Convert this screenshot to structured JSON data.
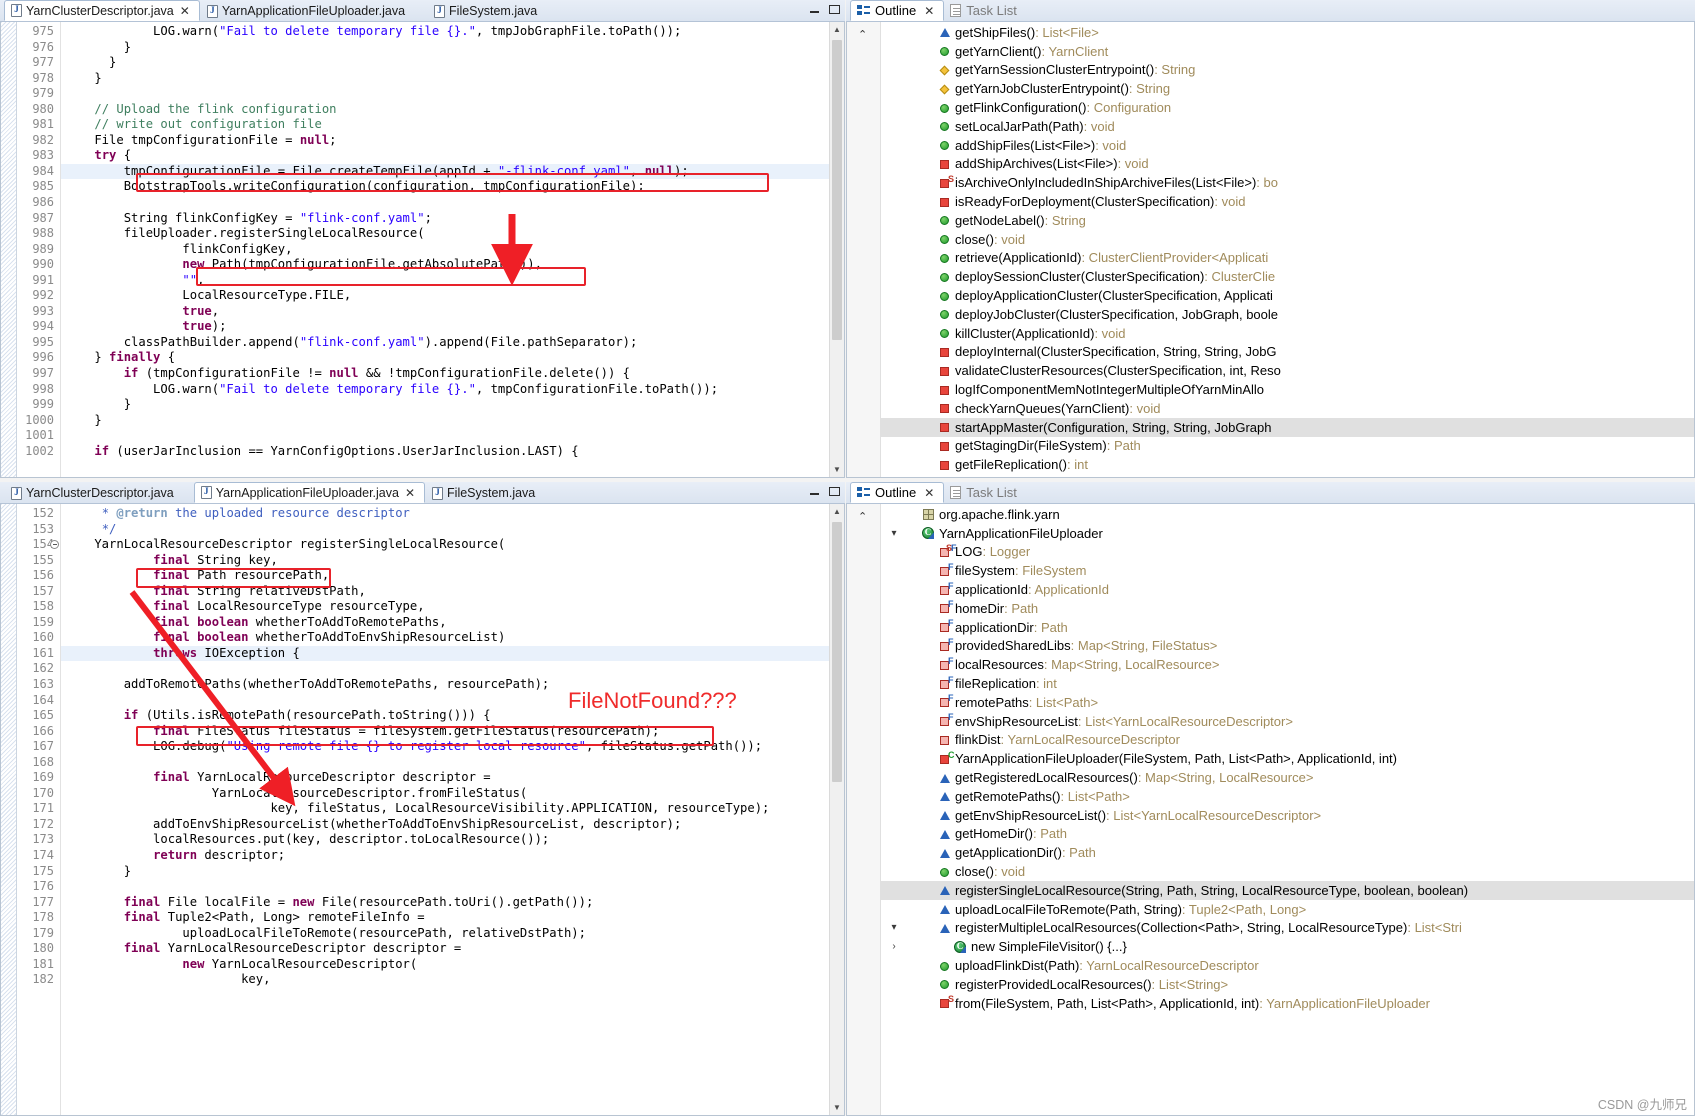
{
  "top_editor": {
    "tabs": [
      {
        "label": "YarnClusterDescriptor.java",
        "active": true,
        "close": "✕"
      },
      {
        "label": "YarnApplicationFileUploader.java",
        "active": false,
        "close": ""
      },
      {
        "label": "FileSystem.java",
        "active": false,
        "close": ""
      }
    ],
    "window_buttons": {
      "minimize": "minimize-icon",
      "maximize": "maximize-icon"
    },
    "first_line_number": 975,
    "lines": [
      {
        "n": "975",
        "text": "            LOG.warn(\"Fail to delete temporary file {}.\", tmpJobGraphFile.toPath());"
      },
      {
        "n": "976",
        "text": "        }"
      },
      {
        "n": "977",
        "text": "      }"
      },
      {
        "n": "978",
        "text": "    }"
      },
      {
        "n": "979",
        "text": ""
      },
      {
        "n": "980",
        "text": "    // Upload the flink configuration"
      },
      {
        "n": "981",
        "text": "    // write out configuration file"
      },
      {
        "n": "982",
        "text": "    File tmpConfigurationFile = null;"
      },
      {
        "n": "983",
        "text": "    try {"
      },
      {
        "n": "984",
        "text": "        tmpConfigurationFile = File.createTempFile(appId + \"-flink-conf.yaml\", null);"
      },
      {
        "n": "985",
        "text": "        BootstrapTools.writeConfiguration(configuration, tmpConfigurationFile);"
      },
      {
        "n": "986",
        "text": ""
      },
      {
        "n": "987",
        "text": "        String flinkConfigKey = \"flink-conf.yaml\";"
      },
      {
        "n": "988",
        "text": "        fileUploader.registerSingleLocalResource("
      },
      {
        "n": "989",
        "text": "                flinkConfigKey,"
      },
      {
        "n": "990",
        "text": "                new Path(tmpConfigurationFile.getAbsolutePath()),"
      },
      {
        "n": "991",
        "text": "                \"\","
      },
      {
        "n": "992",
        "text": "                LocalResourceType.FILE,"
      },
      {
        "n": "993",
        "text": "                true,"
      },
      {
        "n": "994",
        "text": "                true);"
      },
      {
        "n": "995",
        "text": "        classPathBuilder.append(\"flink-conf.yaml\").append(File.pathSeparator);"
      },
      {
        "n": "996",
        "text": "    } finally {"
      },
      {
        "n": "997",
        "text": "        if (tmpConfigurationFile != null && !tmpConfigurationFile.delete()) {"
      },
      {
        "n": "998",
        "text": "            LOG.warn(\"Fail to delete temporary file {}.\", tmpConfigurationFile.toPath());"
      },
      {
        "n": "999",
        "text": "        }"
      },
      {
        "n": "1000",
        "text": "    }"
      },
      {
        "n": "1001",
        "text": ""
      },
      {
        "n": "1002",
        "text": "    if (userJarInclusion == YarnConfigOptions.UserJarInclusion.LAST) {"
      }
    ]
  },
  "bottom_editor": {
    "tabs": [
      {
        "label": "YarnClusterDescriptor.java",
        "active": false,
        "close": ""
      },
      {
        "label": "YarnApplicationFileUploader.java",
        "active": true,
        "close": "✕"
      },
      {
        "label": "FileSystem.java",
        "active": false,
        "close": ""
      }
    ],
    "window_buttons": {
      "minimize": "minimize-icon",
      "maximize": "maximize-icon"
    },
    "lines": [
      {
        "n": "152",
        "text": "     * @return the uploaded resource descriptor"
      },
      {
        "n": "153",
        "text": "     */"
      },
      {
        "n": "154",
        "text": "    YarnLocalResourceDescriptor registerSingleLocalResource(",
        "fold": true
      },
      {
        "n": "155",
        "text": "            final String key,"
      },
      {
        "n": "156",
        "text": "            final Path resourcePath,"
      },
      {
        "n": "157",
        "text": "            final String relativeDstPath,"
      },
      {
        "n": "158",
        "text": "            final LocalResourceType resourceType,"
      },
      {
        "n": "159",
        "text": "            final boolean whetherToAddToRemotePaths,"
      },
      {
        "n": "160",
        "text": "            final boolean whetherToAddToEnvShipResourceList)"
      },
      {
        "n": "161",
        "text": "            throws IOException {"
      },
      {
        "n": "162",
        "text": ""
      },
      {
        "n": "163",
        "text": "        addToRemotePaths(whetherToAddToRemotePaths, resourcePath);"
      },
      {
        "n": "164",
        "text": ""
      },
      {
        "n": "165",
        "text": "        if (Utils.isRemotePath(resourcePath.toString())) {"
      },
      {
        "n": "166",
        "text": "            final FileStatus fileStatus = fileSystem.getFileStatus(resourcePath);"
      },
      {
        "n": "167",
        "text": "            LOG.debug(\"Using remote file {} to register local resource\", fileStatus.getPath());"
      },
      {
        "n": "168",
        "text": ""
      },
      {
        "n": "169",
        "text": "            final YarnLocalResourceDescriptor descriptor ="
      },
      {
        "n": "170",
        "text": "                    YarnLocalResourceDescriptor.fromFileStatus("
      },
      {
        "n": "171",
        "text": "                            key, fileStatus, LocalResourceVisibility.APPLICATION, resourceType);"
      },
      {
        "n": "172",
        "text": "            addToEnvShipResourceList(whetherToAddToEnvShipResourceList, descriptor);"
      },
      {
        "n": "173",
        "text": "            localResources.put(key, descriptor.toLocalResource());"
      },
      {
        "n": "174",
        "text": "            return descriptor;"
      },
      {
        "n": "175",
        "text": "        }"
      },
      {
        "n": "176",
        "text": ""
      },
      {
        "n": "177",
        "text": "        final File localFile = new File(resourcePath.toUri().getPath());"
      },
      {
        "n": "178",
        "text": "        final Tuple2<Path, Long> remoteFileInfo ="
      },
      {
        "n": "179",
        "text": "                uploadLocalFileToRemote(resourcePath, relativeDstPath);"
      },
      {
        "n": "180",
        "text": "        final YarnLocalResourceDescriptor descriptor ="
      },
      {
        "n": "181",
        "text": "                new YarnLocalResourceDescriptor("
      },
      {
        "n": "182",
        "text": "                        key,"
      }
    ]
  },
  "top_outline": {
    "tabs": [
      {
        "label": "Outline",
        "active": true,
        "close": "✕",
        "icon": "outline-icon"
      },
      {
        "label": "Task List",
        "active": false,
        "close": "",
        "icon": "task-list-icon"
      }
    ],
    "items": [
      {
        "name": "getShipFiles()",
        "type": "List<File>",
        "icon": "blue-triangle",
        "badge": ""
      },
      {
        "name": "getYarnClient()",
        "type": "YarnClient",
        "icon": "green-circle",
        "badge": ""
      },
      {
        "name": "getYarnSessionClusterEntrypoint()",
        "type": "String",
        "icon": "yellow-diamond",
        "badge": ""
      },
      {
        "name": "getYarnJobClusterEntrypoint()",
        "type": "String",
        "icon": "yellow-diamond",
        "badge": ""
      },
      {
        "name": "getFlinkConfiguration()",
        "type": "Configuration",
        "icon": "green-circle",
        "badge": ""
      },
      {
        "name": "setLocalJarPath(Path)",
        "type": "void",
        "icon": "green-circle",
        "badge": ""
      },
      {
        "name": "addShipFiles(List<File>)",
        "type": "void",
        "icon": "green-circle",
        "badge": ""
      },
      {
        "name": "addShipArchives(List<File>)",
        "type": "void",
        "icon": "red-square",
        "badge": ""
      },
      {
        "name": "isArchiveOnlyIncludedInShipArchiveFiles(List<File>)",
        "type": "bo",
        "icon": "red-square",
        "badge": "S"
      },
      {
        "name": "isReadyForDeployment(ClusterSpecification)",
        "type": "void",
        "icon": "red-square",
        "badge": ""
      },
      {
        "name": "getNodeLabel()",
        "type": "String",
        "icon": "green-circle",
        "badge": ""
      },
      {
        "name": "close()",
        "type": "void",
        "icon": "green-circle",
        "badge": ""
      },
      {
        "name": "retrieve(ApplicationId)",
        "type": "ClusterClientProvider<Applicati",
        "icon": "green-circle",
        "badge": ""
      },
      {
        "name": "deploySessionCluster(ClusterSpecification)",
        "type": "ClusterClie",
        "icon": "green-circle",
        "badge": ""
      },
      {
        "name": "deployApplicationCluster(ClusterSpecification, Applicati",
        "type": "",
        "icon": "green-circle",
        "badge": ""
      },
      {
        "name": "deployJobCluster(ClusterSpecification, JobGraph, boole",
        "type": "",
        "icon": "green-circle",
        "badge": ""
      },
      {
        "name": "killCluster(ApplicationId)",
        "type": "void",
        "icon": "green-circle",
        "badge": ""
      },
      {
        "name": "deployInternal(ClusterSpecification, String, String, JobG",
        "type": "",
        "icon": "red-square",
        "badge": ""
      },
      {
        "name": "validateClusterResources(ClusterSpecification, int, Reso",
        "type": "",
        "icon": "red-square",
        "badge": ""
      },
      {
        "name": "logIfComponentMemNotIntegerMultipleOfYarnMinAllo",
        "type": "",
        "icon": "red-square",
        "badge": ""
      },
      {
        "name": "checkYarnQueues(YarnClient)",
        "type": "void",
        "icon": "red-square",
        "badge": ""
      },
      {
        "name": "startAppMaster(Configuration, String, String, JobGraph",
        "type": "",
        "icon": "red-square",
        "badge": "",
        "selected": true
      },
      {
        "name": "getStagingDir(FileSystem)",
        "type": "Path",
        "icon": "red-square",
        "badge": ""
      },
      {
        "name": "getFileReplication()",
        "type": "int",
        "icon": "red-square",
        "badge": ""
      }
    ]
  },
  "bottom_outline": {
    "tabs": [
      {
        "label": "Outline",
        "active": true,
        "close": "✕",
        "icon": "outline-icon"
      },
      {
        "label": "Task List",
        "active": false,
        "close": "",
        "icon": "task-list-icon"
      }
    ],
    "items": [
      {
        "name": "org.apache.flink.yarn",
        "type": "",
        "icon": "package",
        "badge": "",
        "indent": 0
      },
      {
        "name": "YarnApplicationFileUploader",
        "type": "",
        "icon": "class",
        "badge": "",
        "indent": 0,
        "twisty": "▾"
      },
      {
        "name": "LOG",
        "type": "Logger",
        "icon": "red-square-hollow",
        "badge": "SF",
        "indent": 1
      },
      {
        "name": "fileSystem",
        "type": "FileSystem",
        "icon": "red-square-hollow",
        "badge": "F",
        "indent": 1
      },
      {
        "name": "applicationId",
        "type": "ApplicationId",
        "icon": "red-square-hollow",
        "badge": "F",
        "indent": 1
      },
      {
        "name": "homeDir",
        "type": "Path",
        "icon": "red-square-hollow",
        "badge": "F",
        "indent": 1
      },
      {
        "name": "applicationDir",
        "type": "Path",
        "icon": "red-square-hollow",
        "badge": "F",
        "indent": 1
      },
      {
        "name": "providedSharedLibs",
        "type": "Map<String, FileStatus>",
        "icon": "red-square-hollow",
        "badge": "F",
        "indent": 1
      },
      {
        "name": "localResources",
        "type": "Map<String, LocalResource>",
        "icon": "red-square-hollow",
        "badge": "F",
        "indent": 1
      },
      {
        "name": "fileReplication",
        "type": "int",
        "icon": "red-square-hollow",
        "badge": "F",
        "indent": 1
      },
      {
        "name": "remotePaths",
        "type": "List<Path>",
        "icon": "red-square-hollow",
        "badge": "F",
        "indent": 1
      },
      {
        "name": "envShipResourceList",
        "type": "List<YarnLocalResourceDescriptor>",
        "icon": "red-square-hollow",
        "badge": "F",
        "indent": 1
      },
      {
        "name": "flinkDist",
        "type": "YarnLocalResourceDescriptor",
        "icon": "red-square-hollow",
        "badge": "",
        "indent": 1
      },
      {
        "name": "YarnApplicationFileUploader(FileSystem, Path, List<Path>, ApplicationId, int)",
        "type": "",
        "icon": "red-square",
        "badge": "C",
        "indent": 1
      },
      {
        "name": "getRegisteredLocalResources()",
        "type": "Map<String, LocalResource>",
        "icon": "blue-triangle",
        "badge": "",
        "indent": 1
      },
      {
        "name": "getRemotePaths()",
        "type": "List<Path>",
        "icon": "blue-triangle",
        "badge": "",
        "indent": 1
      },
      {
        "name": "getEnvShipResourceList()",
        "type": "List<YarnLocalResourceDescriptor>",
        "icon": "blue-triangle",
        "badge": "",
        "indent": 1
      },
      {
        "name": "getHomeDir()",
        "type": "Path",
        "icon": "blue-triangle",
        "badge": "",
        "indent": 1
      },
      {
        "name": "getApplicationDir()",
        "type": "Path",
        "icon": "blue-triangle",
        "badge": "",
        "indent": 1
      },
      {
        "name": "close()",
        "type": "void",
        "icon": "green-circle",
        "badge": "",
        "indent": 1
      },
      {
        "name": "registerSingleLocalResource(String, Path, String, LocalResourceType, boolean, boolean)",
        "type": "",
        "icon": "blue-triangle",
        "badge": "",
        "indent": 1,
        "selected": true
      },
      {
        "name": "uploadLocalFileToRemote(Path, String)",
        "type": "Tuple2<Path, Long>",
        "icon": "blue-triangle",
        "badge": "",
        "indent": 1
      },
      {
        "name": "registerMultipleLocalResources(Collection<Path>, String, LocalResourceType)",
        "type": "List<Stri",
        "icon": "blue-triangle",
        "badge": "",
        "indent": 1,
        "twisty": "▾"
      },
      {
        "name": "new SimpleFileVisitor() {...}",
        "type": "",
        "icon": "class",
        "badge": "",
        "indent": 2,
        "twisty": "›"
      },
      {
        "name": "uploadFlinkDist(Path)",
        "type": "YarnLocalResourceDescriptor",
        "icon": "green-circle",
        "badge": "",
        "indent": 1
      },
      {
        "name": "registerProvidedLocalResources()",
        "type": "List<String>",
        "icon": "green-circle",
        "badge": "",
        "indent": 1
      },
      {
        "name": "from(FileSystem, Path, List<Path>, ApplicationId, int)",
        "type": "YarnApplicationFileUploader",
        "icon": "red-square",
        "badge": "S",
        "indent": 1
      }
    ]
  },
  "annotations": {
    "file_not_found_label": "FileNotFound???",
    "accent_color": "#e8222a"
  },
  "watermark": "CSDN @九师兄"
}
